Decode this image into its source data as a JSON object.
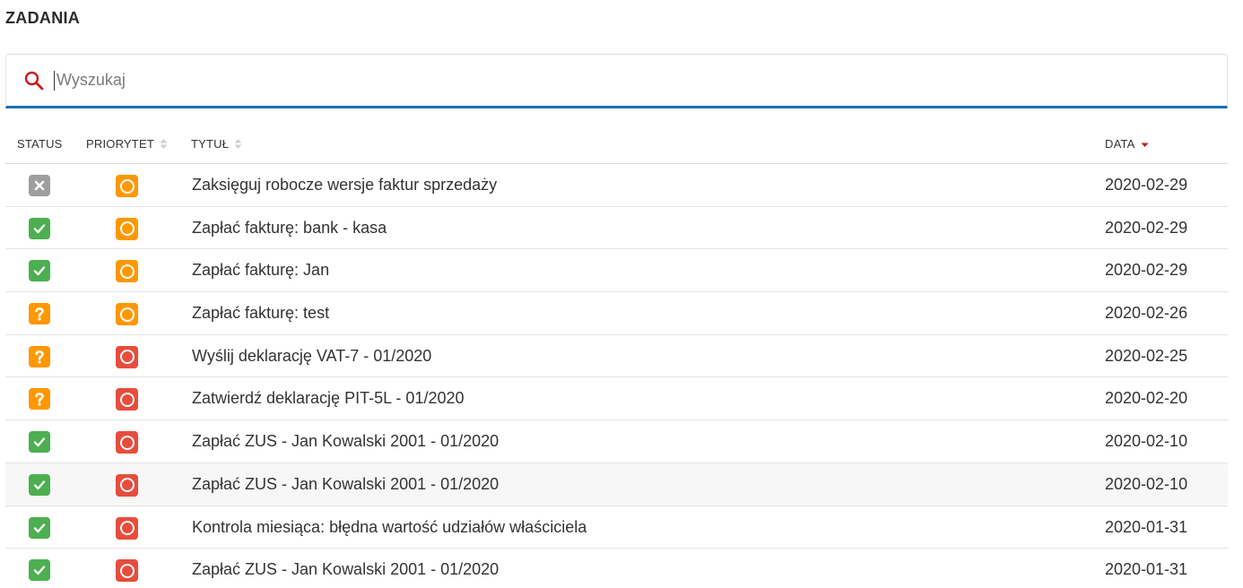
{
  "header": {
    "title": "ZADANIA"
  },
  "search": {
    "placeholder": "Wyszukaj",
    "value": ""
  },
  "table": {
    "columns": {
      "status": "STATUS",
      "priority": "PRIORYTET",
      "title": "TYTUŁ",
      "date": "DATA"
    },
    "sort": {
      "column": "date",
      "direction": "desc",
      "active_color": "#cc1a1a"
    },
    "rows": [
      {
        "status": "cancelled",
        "priority": "medium",
        "title": "Zaksięguj robocze wersje faktur sprzedaży",
        "date": "2020-02-29"
      },
      {
        "status": "done",
        "priority": "medium",
        "title": "Zapłać fakturę: bank - kasa",
        "date": "2020-02-29"
      },
      {
        "status": "done",
        "priority": "medium",
        "title": "Zapłać fakturę: Jan",
        "date": "2020-02-29"
      },
      {
        "status": "pending",
        "priority": "medium",
        "title": "Zapłać fakturę: test",
        "date": "2020-02-26"
      },
      {
        "status": "pending",
        "priority": "high",
        "title": "Wyślij deklarację VAT-7 - 01/2020",
        "date": "2020-02-25"
      },
      {
        "status": "pending",
        "priority": "high",
        "title": "Zatwierdź deklarację PIT-5L - 01/2020",
        "date": "2020-02-20"
      },
      {
        "status": "done",
        "priority": "high",
        "title": "Zapłać ZUS - Jan Kowalski 2001 - 01/2020",
        "date": "2020-02-10"
      },
      {
        "status": "done",
        "priority": "high",
        "title": "Zapłać ZUS - Jan Kowalski 2001 - 01/2020",
        "date": "2020-02-10"
      },
      {
        "status": "done",
        "priority": "high",
        "title": "Kontrola miesiąca: błędna wartość udziałów właściciela",
        "date": "2020-01-31"
      },
      {
        "status": "done",
        "priority": "high",
        "title": "Zapłać ZUS - Jan Kowalski 2001 - 01/2020",
        "date": "2020-01-31"
      }
    ],
    "highlighted_row": 7
  },
  "colors": {
    "done": "#4caf50",
    "pending": "#ff9800",
    "cancelled": "#9e9e9e",
    "priority_medium": "#ff9800",
    "priority_high": "#e84c3d",
    "search_underline": "#1a6fb3",
    "search_icon": "#cc1a1a"
  },
  "icons": {
    "done": "check-icon",
    "pending": "question-icon",
    "cancelled": "x-icon",
    "priority": "circle-icon",
    "search": "search-icon"
  }
}
